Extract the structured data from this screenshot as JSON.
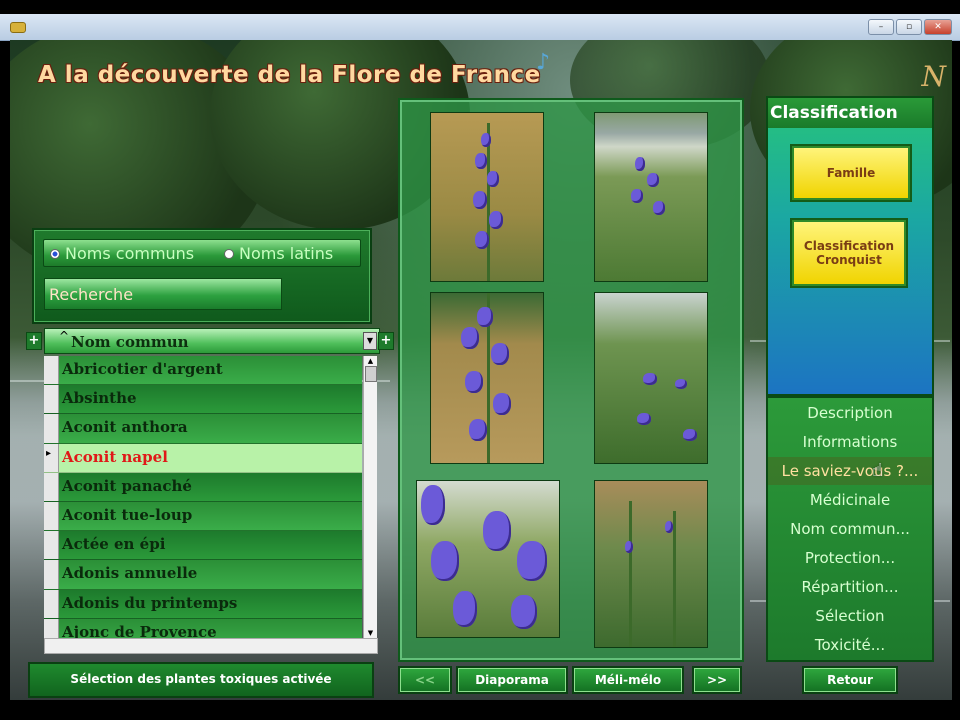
{
  "app": {
    "title": "A la découverte de la Flore de France",
    "logo_glyph": "N",
    "music_glyph": "♪",
    "window_buttons": [
      "–",
      "▫",
      "✕"
    ]
  },
  "name_mode": {
    "options": [
      {
        "label": "Noms communs",
        "selected": true
      },
      {
        "label": "Noms latins",
        "selected": false
      }
    ],
    "search_value": "Recherche"
  },
  "list": {
    "add_left": "+",
    "add_right": "+",
    "header": "Nom commun",
    "sort_glyph": "^",
    "items": [
      "Abricotier d'argent",
      "Absinthe",
      "Aconit anthora",
      "Aconit napel",
      "Aconit panaché",
      "Aconit tue-loup",
      "Actée en épi",
      "Adonis annuelle",
      "Adonis du printemps",
      "Ajonc de Provence"
    ],
    "selected_index": 3
  },
  "status_text": "Sélection des plantes toxiques activée",
  "gallery": {
    "photo_count": 6
  },
  "classification": {
    "title": "Classification",
    "buttons": [
      "Famille",
      "Classification Cronquist"
    ]
  },
  "menu": {
    "items": [
      "Description",
      "Informations",
      "Le saviez-vous ?...",
      "Médicinale",
      "Nom commun...",
      "Protection...",
      "Répartition...",
      "Sélection",
      "Toxicité..."
    ],
    "hovered_index": 2
  },
  "nav": {
    "prev": "<<",
    "slideshow": "Diaporama",
    "mix": "Méli-mélo",
    "next": ">>",
    "back": "Retour"
  },
  "colors": {
    "accent_green": "#1f7a2c",
    "selected_text": "#e01818",
    "title_text": "#ffd9a0",
    "button_yellow": "#fff47a"
  }
}
